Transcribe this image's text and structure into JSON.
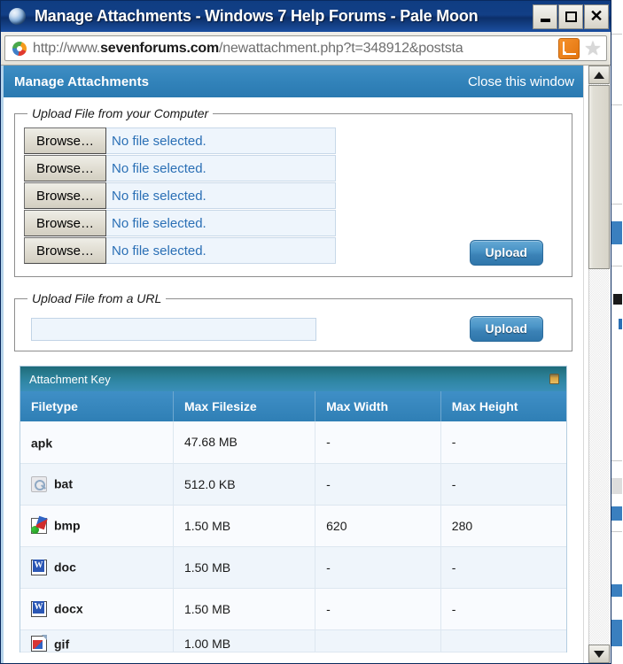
{
  "window": {
    "title": "Manage Attachments - Windows 7 Help Forums - Pale Moon",
    "app_icon": "palemoon-icon",
    "minimize_label": "_",
    "maximize_label": "□",
    "close_label": "✕"
  },
  "navbar": {
    "favicon": "palemoon-favicon",
    "url_prefix": "http://www.",
    "url_domain": "sevenforums.com",
    "url_path": "/newattachment.php?t=348912&poststa",
    "url_full": "http://www.sevenforums.com/newattachment.php?t=348912&poststa",
    "rss_icon": "rss-feed-icon",
    "bookmark_icon": "star-bookmark-icon",
    "bookmark_glyph": "★"
  },
  "page": {
    "header": {
      "title": "Manage Attachments",
      "close_link": "Close this window"
    },
    "upload_computer": {
      "legend": "Upload File from your Computer",
      "rows": [
        {
          "browse_label": "Browse…",
          "file_status": "No file selected."
        },
        {
          "browse_label": "Browse…",
          "file_status": "No file selected."
        },
        {
          "browse_label": "Browse…",
          "file_status": "No file selected."
        },
        {
          "browse_label": "Browse…",
          "file_status": "No file selected."
        },
        {
          "browse_label": "Browse…",
          "file_status": "No file selected."
        }
      ],
      "upload_label": "Upload"
    },
    "upload_url": {
      "legend": "Upload File from a URL",
      "input_value": "",
      "input_placeholder": "",
      "upload_label": "Upload"
    },
    "attachment_key": {
      "bar_title": "Attachment Key",
      "collapse_icon": "collapse-toggle-icon",
      "columns": [
        "Filetype",
        "Max Filesize",
        "Max Width",
        "Max Height"
      ],
      "rows": [
        {
          "icon": "",
          "filetype": "apk",
          "max_filesize": "47.68 MB",
          "max_width": "-",
          "max_height": "-"
        },
        {
          "icon": "bat-file-icon",
          "filetype": "bat",
          "max_filesize": "512.0 KB",
          "max_width": "-",
          "max_height": "-"
        },
        {
          "icon": "bmp-file-icon",
          "filetype": "bmp",
          "max_filesize": "1.50 MB",
          "max_width": "620",
          "max_height": "280"
        },
        {
          "icon": "doc-file-icon",
          "filetype": "doc",
          "max_filesize": "1.50 MB",
          "max_width": "-",
          "max_height": "-"
        },
        {
          "icon": "docx-file-icon",
          "filetype": "docx",
          "max_filesize": "1.50 MB",
          "max_width": "-",
          "max_height": "-"
        },
        {
          "icon": "gif-file-icon",
          "filetype": "gif",
          "max_filesize": "1.00 MB",
          "max_width": "",
          "max_height": ""
        }
      ]
    }
  },
  "colors": {
    "titlebar": "#12407f",
    "page_header_blue": "#3283ba",
    "table_header_blue": "#2f7fb5",
    "attachment_bar_teal": "#2a7d92",
    "link_blue": "#2a6fb5",
    "upload_button": "#3b82b6"
  }
}
